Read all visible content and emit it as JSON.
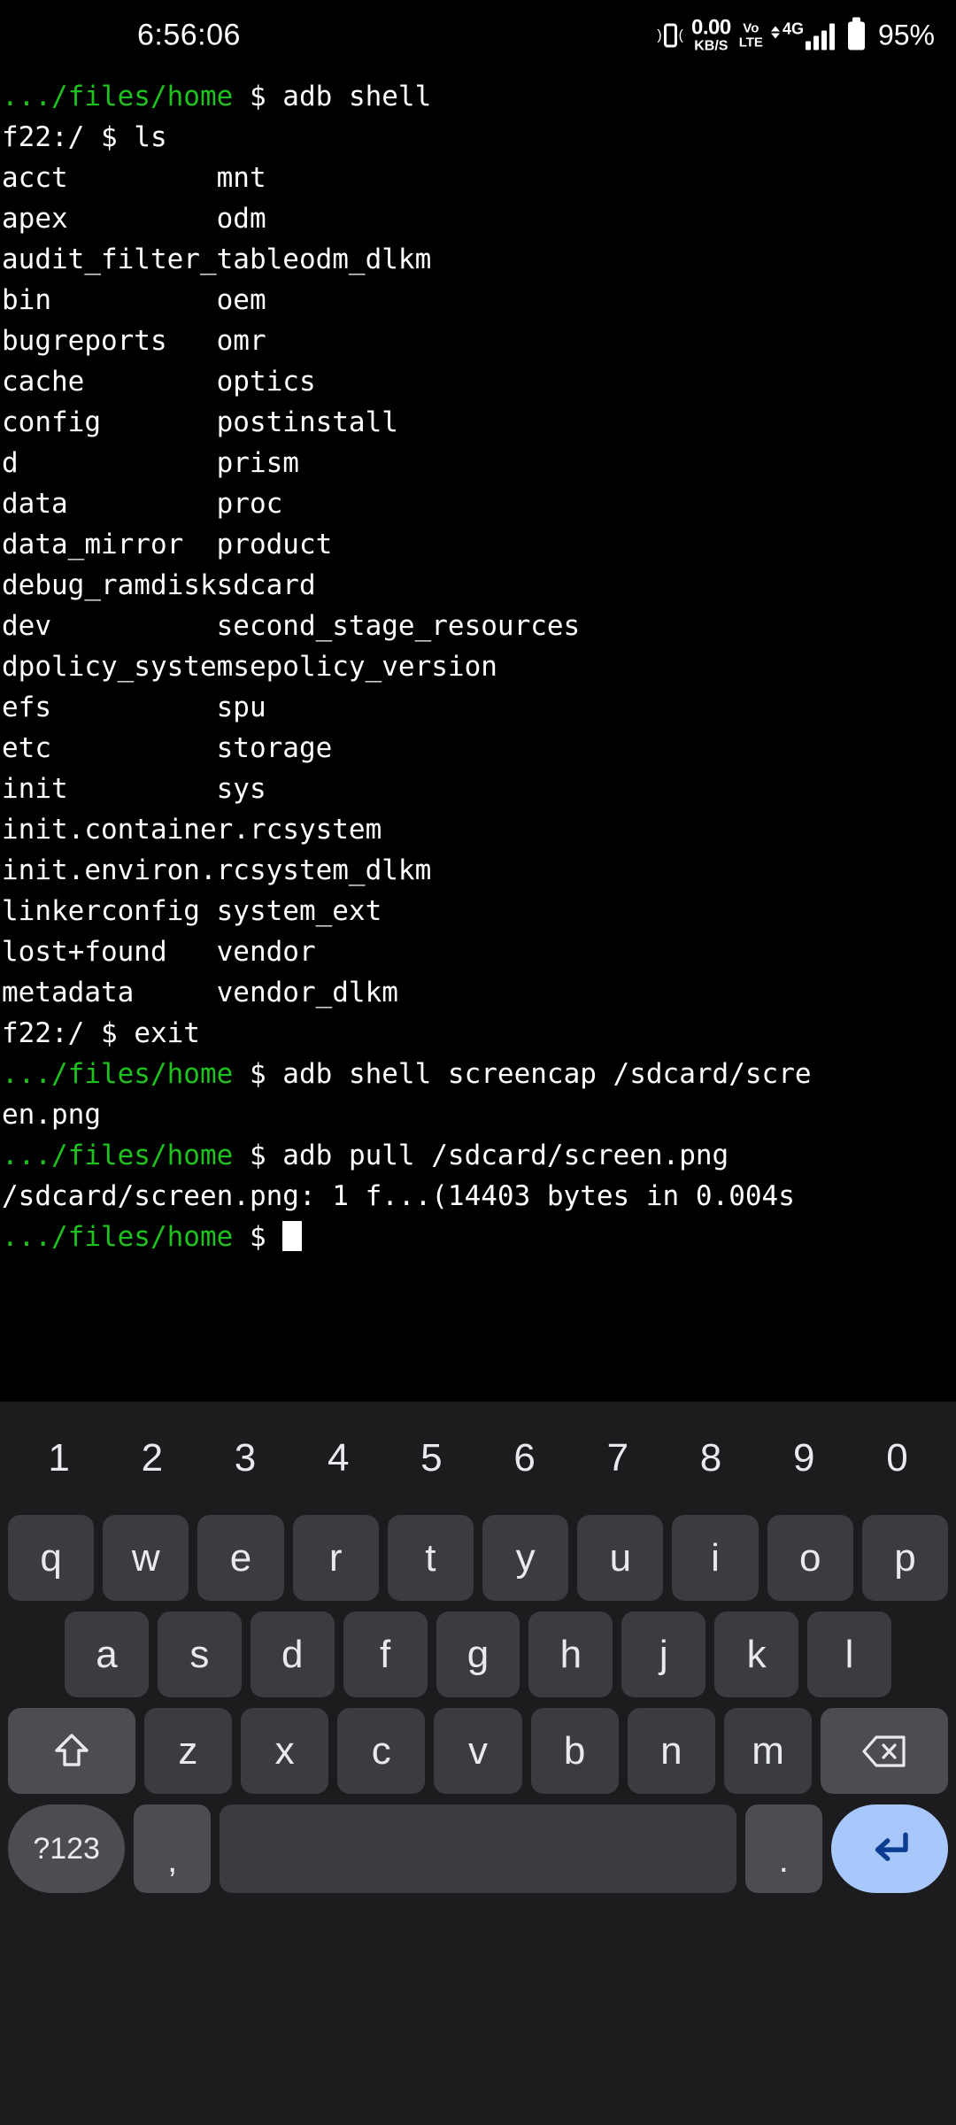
{
  "status_bar": {
    "clock": "6:56:06",
    "vibrate_icon": "vibrate-icon",
    "net_speed_value": "0.00",
    "net_speed_unit": "KB/S",
    "volte_top": "Vo",
    "volte_bottom": "LTE",
    "network_type": "4G",
    "signal_icon": "signal-bars-icon",
    "battery_icon": "battery-icon",
    "battery_percent": "95%"
  },
  "terminal": {
    "prompt_home": ".../files/home",
    "prompt_device": "f22:/",
    "dollar": "$",
    "lines": [
      {
        "type": "cmd",
        "prompt": ".../files/home",
        "text": " $ adb shell"
      },
      {
        "type": "cmd",
        "prompt": "f22:/",
        "text": " $ ls",
        "plain": true
      },
      {
        "type": "cols",
        "left": "acct",
        "right": "mnt"
      },
      {
        "type": "cols",
        "left": "apex",
        "right": "odm"
      },
      {
        "type": "cols",
        "left": "audit_filter_table",
        "right": "odm_dlkm"
      },
      {
        "type": "cols",
        "left": "bin",
        "right": "oem"
      },
      {
        "type": "cols",
        "left": "bugreports",
        "right": "omr"
      },
      {
        "type": "cols",
        "left": "cache",
        "right": "optics"
      },
      {
        "type": "cols",
        "left": "config",
        "right": "postinstall"
      },
      {
        "type": "cols",
        "left": "d",
        "right": "prism"
      },
      {
        "type": "cols",
        "left": "data",
        "right": "proc"
      },
      {
        "type": "cols",
        "left": "data_mirror",
        "right": "product"
      },
      {
        "type": "cols",
        "left": "debug_ramdisk",
        "right": "sdcard"
      },
      {
        "type": "cols",
        "left": "dev",
        "right": "second_stage_resources"
      },
      {
        "type": "cols",
        "left": "dpolicy_system",
        "right": "sepolicy_version"
      },
      {
        "type": "cols",
        "left": "efs",
        "right": "spu"
      },
      {
        "type": "cols",
        "left": "etc",
        "right": "storage"
      },
      {
        "type": "cols",
        "left": "init",
        "right": "sys"
      },
      {
        "type": "cols",
        "left": "init.container.rc",
        "right": "system"
      },
      {
        "type": "cols",
        "left": "init.environ.rc",
        "right": "system_dlkm"
      },
      {
        "type": "cols",
        "left": "linkerconfig",
        "right": "system_ext"
      },
      {
        "type": "cols",
        "left": "lost+found",
        "right": "vendor"
      },
      {
        "type": "cols",
        "left": "metadata",
        "right": "vendor_dlkm"
      },
      {
        "type": "cmd",
        "prompt": "f22:/",
        "text": " $ exit",
        "plain": true
      },
      {
        "type": "cmd",
        "prompt": ".../files/home",
        "text": " $ adb shell screencap /sdcard/scre"
      },
      {
        "type": "out",
        "text": "en.png"
      },
      {
        "type": "cmd",
        "prompt": ".../files/home",
        "text": " $ adb pull /sdcard/screen.png"
      },
      {
        "type": "out",
        "text": "/sdcard/screen.png: 1 f...(14403 bytes in 0.004s"
      },
      {
        "type": "cursor",
        "prompt": ".../files/home",
        "text": " $ "
      }
    ]
  },
  "keyboard": {
    "number_row": [
      "1",
      "2",
      "3",
      "4",
      "5",
      "6",
      "7",
      "8",
      "9",
      "0"
    ],
    "row1": [
      "q",
      "w",
      "e",
      "r",
      "t",
      "y",
      "u",
      "i",
      "o",
      "p"
    ],
    "row2": [
      "a",
      "s",
      "d",
      "f",
      "g",
      "h",
      "j",
      "k",
      "l"
    ],
    "row3": {
      "shift_icon": "shift-arrow-icon",
      "letters": [
        "z",
        "x",
        "c",
        "v",
        "b",
        "n",
        "m"
      ],
      "backspace_icon": "backspace-icon"
    },
    "row4": {
      "symbols_label": "?123",
      "comma_label": ",",
      "space_label": "",
      "period_label": ".",
      "enter_icon": "enter-arrow-icon"
    },
    "colors": {
      "background": "#1c1c1e",
      "key": "#3a3c3f",
      "modifier_key": "#4b4d50",
      "enter_key": "#a8c7fa",
      "enter_glyph": "#0b3d91",
      "key_text": "#e8eaed"
    }
  },
  "theme": {
    "terminal_background": "#000000",
    "terminal_text": "#ffffff",
    "prompt_green": "#1ec11e",
    "cursor": "#ffffff"
  }
}
